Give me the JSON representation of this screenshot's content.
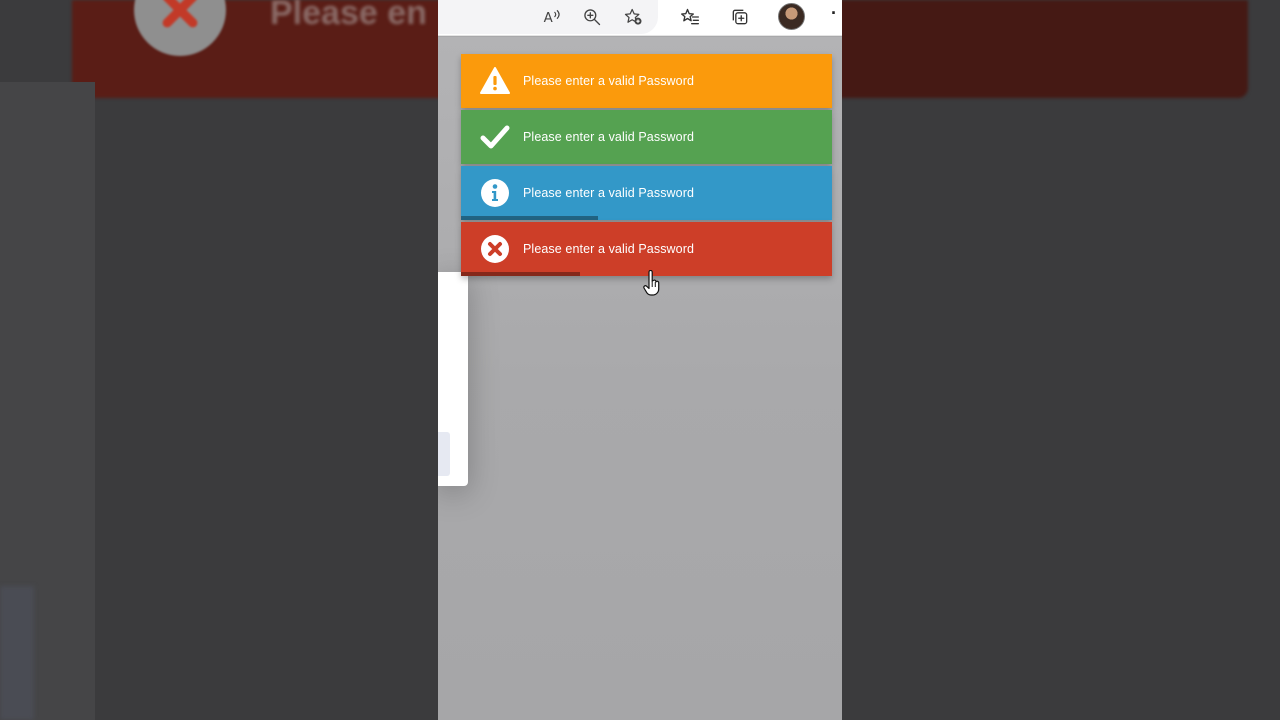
{
  "background": {
    "banner_text": "Please en"
  },
  "browser": {
    "toolbar_icons": [
      "read-aloud-icon",
      "zoom-in-icon",
      "add-favorite-icon",
      "favorites-icon",
      "collections-icon",
      "profile-avatar",
      "more-menu-icon"
    ],
    "more_label": "·"
  },
  "toasts": [
    {
      "type": "warning",
      "icon": "warning-icon",
      "color": "#fb9a0c",
      "message": "Please enter a valid Password",
      "progress": 0
    },
    {
      "type": "success",
      "icon": "checkmark-icon",
      "color": "#55a251",
      "message": "Please enter a valid Password",
      "progress": 0
    },
    {
      "type": "info",
      "icon": "info-icon",
      "color": "#3398c8",
      "message": "Please enter a valid Password",
      "progress": 0.37
    },
    {
      "type": "error",
      "icon": "error-x-icon",
      "color": "#cd3e28",
      "message": "Please enter a valid Password",
      "progress": 0.32
    }
  ]
}
